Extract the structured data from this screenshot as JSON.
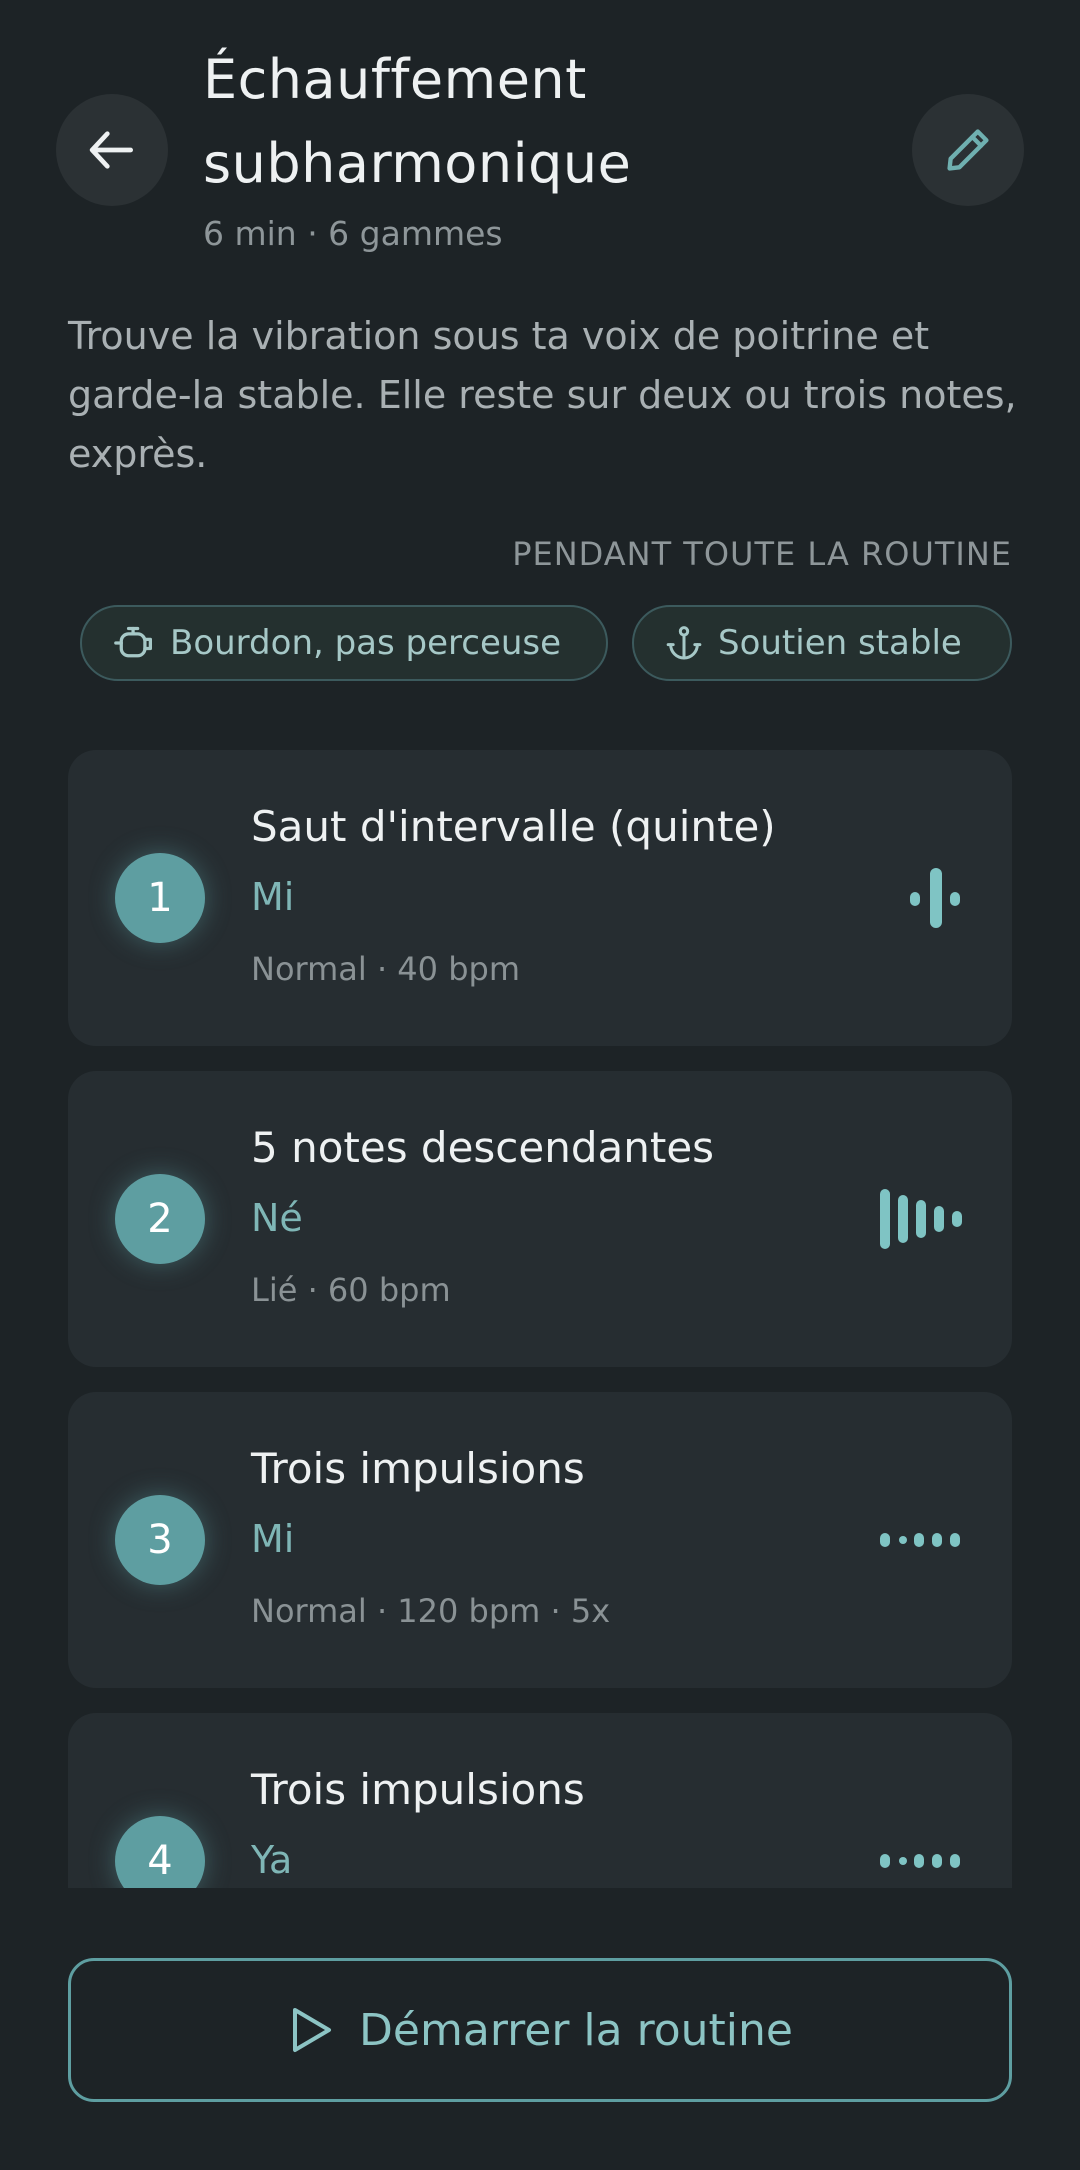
{
  "header": {
    "title": "Échauffement subharmonique",
    "subtitle": "6 min · 6 gammes",
    "back_icon": "arrow-left-icon",
    "edit_icon": "pencil-icon"
  },
  "description": "Trouve la vibration sous ta voix de poitrine et garde-la stable. Elle reste sur deux ou trois notes, exprès.",
  "section_label": "PENDANT TOUTE LA ROUTINE",
  "chips": [
    {
      "label": "Bourdon, pas perceuse",
      "icon": "kettle-icon"
    },
    {
      "label": "Soutien stable",
      "icon": "anchor-icon"
    }
  ],
  "exercises": [
    {
      "number": "1",
      "title": "Saut d'intervalle (quinte)",
      "note": "Mi",
      "meta": "Normal · 40 bpm",
      "icon": "interval-jump-icon"
    },
    {
      "number": "2",
      "title": "5 notes descendantes",
      "note": "Né",
      "meta": "Lié · 60 bpm",
      "icon": "descending-bars-icon"
    },
    {
      "number": "3",
      "title": "Trois impulsions",
      "note": "Mi",
      "meta": "Normal · 120 bpm · 5x",
      "icon": "pulses-icon"
    },
    {
      "number": "4",
      "title": "Trois impulsions",
      "note": "Ya",
      "meta": "",
      "icon": "pulses-icon"
    }
  ],
  "start_button": {
    "label": "Démarrer la routine",
    "icon": "play-icon"
  },
  "colors": {
    "background": "#1d2326",
    "card": "#262d31",
    "accent": "#5e9ea1",
    "accent_text": "#8cc4c4"
  }
}
